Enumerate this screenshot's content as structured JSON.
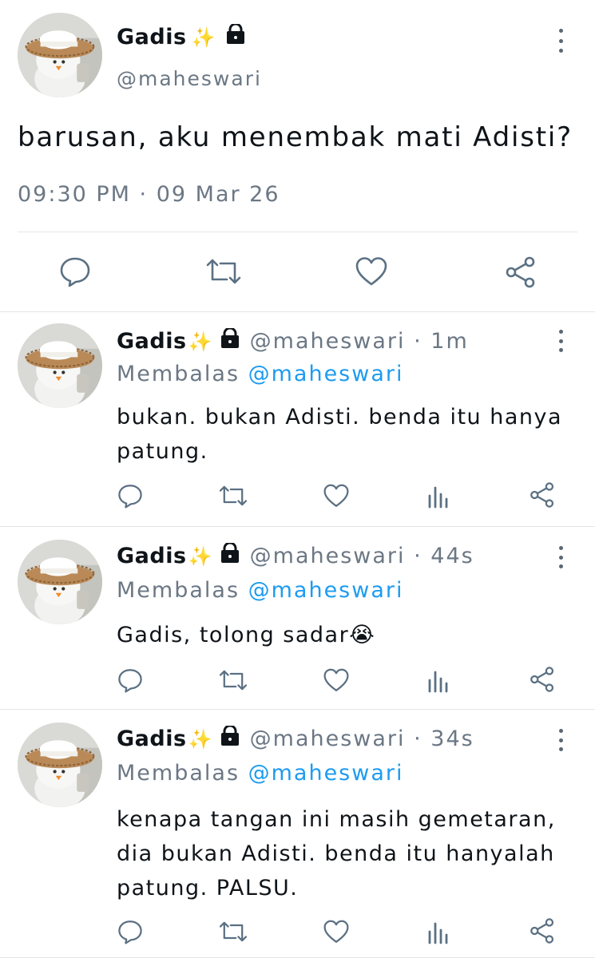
{
  "main_tweet": {
    "name": "Gadis",
    "name_emoji": "✨",
    "handle": "@maheswari",
    "text": "barusan, aku menembak mati Adisti?",
    "timestamp": "09:30 PM · 09 Mar 26",
    "actions": [
      "reply-icon",
      "retweet-icon",
      "like-icon",
      "share-icon"
    ]
  },
  "replies": [
    {
      "name": "Gadis",
      "name_emoji": "✨",
      "handle": "@maheswari",
      "age": "1m",
      "replying_prefix": "Membalas",
      "replying_to": "@maheswari",
      "text": "bukan. bukan Adisti. benda itu hanya patung."
    },
    {
      "name": "Gadis",
      "name_emoji": "✨",
      "handle": "@maheswari",
      "age": "44s",
      "replying_prefix": "Membalas",
      "replying_to": "@maheswari",
      "text": "Gadis, tolong sadar😭"
    },
    {
      "name": "Gadis",
      "name_emoji": "✨",
      "handle": "@maheswari",
      "age": "34s",
      "replying_prefix": "Membalas",
      "replying_to": "@maheswari",
      "text": "kenapa tangan ini masih gemetaran, dia bukan Adisti. benda itu hanyalah patung. PALSU."
    }
  ],
  "colors": {
    "text": "#0f1419",
    "secondary": "#6b7784",
    "mention": "#1d9bf0",
    "divider": "#e3e6e8",
    "icon": "#5b7083"
  },
  "icons": {
    "lock": "lock-icon",
    "more": "more-vertical-icon",
    "reply": "reply-icon",
    "retweet": "retweet-icon",
    "like": "like-icon",
    "views": "views-icon",
    "share": "share-icon"
  }
}
